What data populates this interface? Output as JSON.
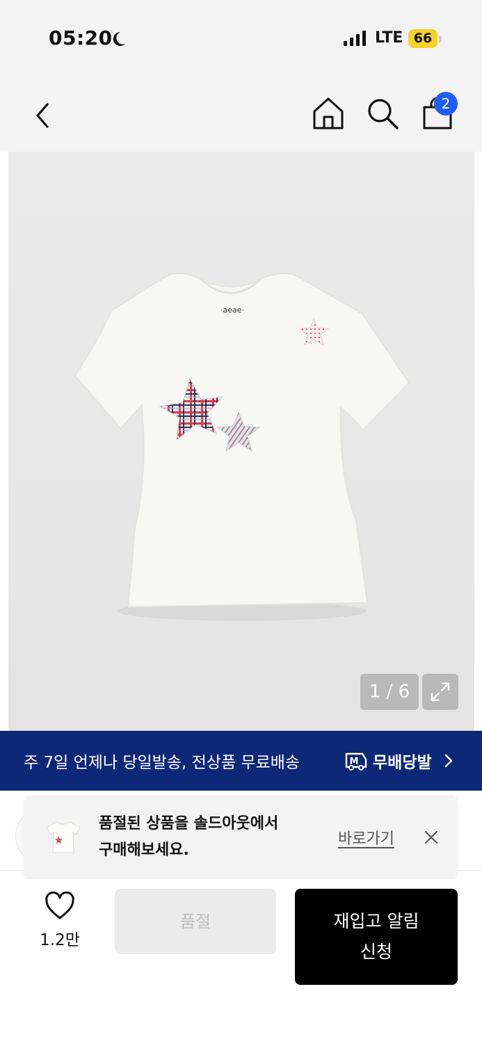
{
  "status_bar": {
    "time": "05:20",
    "network": "LTE",
    "battery": "66",
    "icons": [
      "moon-icon",
      "signal-icon"
    ]
  },
  "nav": {
    "icons": [
      "back-icon",
      "home-icon",
      "search-icon",
      "bag-icon"
    ],
    "cart_count": "2"
  },
  "gallery": {
    "counter": "1 / 6",
    "icons": [
      "expand-icon"
    ],
    "image": {
      "type": "product-photo",
      "subject": "white short-sleeve t-shirt with star patches",
      "brand_tag": "aeae"
    }
  },
  "promo": {
    "text": "주 7일 언제나 당일발송, 전상품 무료배송",
    "brand": "무배당발",
    "logo_letter": "M",
    "color": "#0e2878"
  },
  "toast": {
    "message_line1": "품절된 상품을 솔드아웃에서",
    "message_line2": "구매해보세요.",
    "link_label": "바로가기",
    "icons": [
      "close-icon"
    ]
  },
  "actions": {
    "like_count": "1.2만",
    "soldout_label": "품절",
    "restock_line1": "재입고 알림",
    "restock_line2": "신청"
  },
  "colors": {
    "badge": "#1f5ef5",
    "promo": "#0e2878",
    "primary_button": "#000000"
  }
}
